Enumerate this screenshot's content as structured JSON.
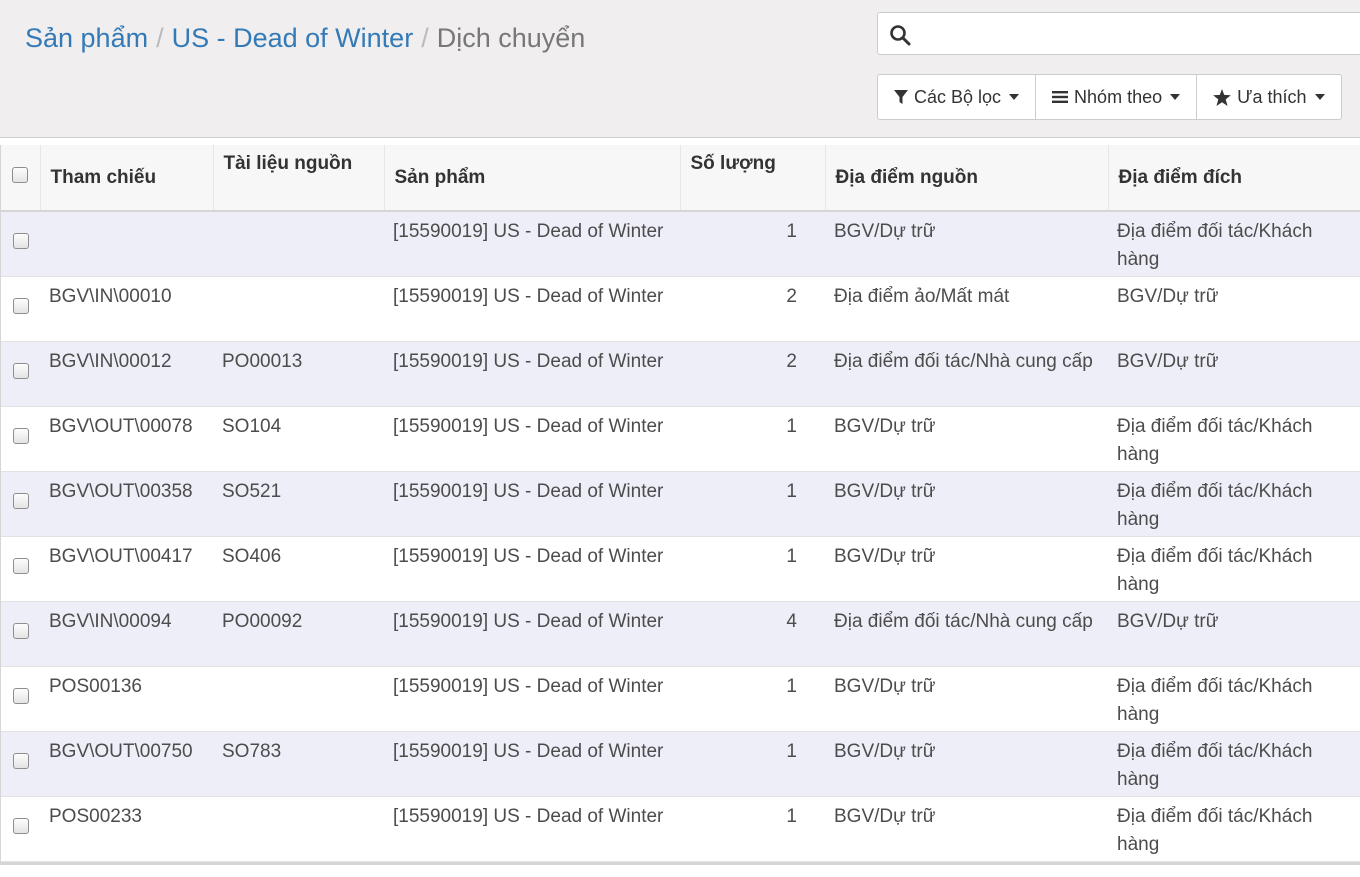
{
  "breadcrumb": {
    "items": [
      "Sản phẩm",
      "US - Dead of Winter"
    ],
    "current": "Dịch chuyển",
    "separator": "/"
  },
  "search": {
    "value": "",
    "placeholder": ""
  },
  "filters": {
    "filter_label": "Các Bộ lọc",
    "group_label": "Nhóm theo",
    "favorite_label": "Ưa thích"
  },
  "table": {
    "columns": [
      "Tham chiếu",
      "Tài liệu nguồn",
      "Sản phẩm",
      "Số lượng",
      "Địa điểm nguồn",
      "Địa điểm đích"
    ],
    "rows": [
      {
        "ref": "",
        "source_doc": "",
        "product": "[15590019] US - Dead of Winter",
        "qty": "1",
        "from": "BGV/Dự trữ",
        "to": "Địa điểm đối tác/Khách hàng"
      },
      {
        "ref": "BGV\\IN\\00010",
        "source_doc": "",
        "product": "[15590019] US - Dead of Winter",
        "qty": "2",
        "from": "Địa điểm ảo/Mất mát",
        "to": "BGV/Dự trữ"
      },
      {
        "ref": "BGV\\IN\\00012",
        "source_doc": "PO00013",
        "product": "[15590019] US - Dead of Winter",
        "qty": "2",
        "from": "Địa điểm đối tác/Nhà cung cấp",
        "to": "BGV/Dự trữ"
      },
      {
        "ref": "BGV\\OUT\\00078",
        "source_doc": "SO104",
        "product": "[15590019] US - Dead of Winter",
        "qty": "1",
        "from": "BGV/Dự trữ",
        "to": "Địa điểm đối tác/Khách hàng"
      },
      {
        "ref": "BGV\\OUT\\00358",
        "source_doc": "SO521",
        "product": "[15590019] US - Dead of Winter",
        "qty": "1",
        "from": "BGV/Dự trữ",
        "to": "Địa điểm đối tác/Khách hàng"
      },
      {
        "ref": "BGV\\OUT\\00417",
        "source_doc": "SO406",
        "product": "[15590019] US - Dead of Winter",
        "qty": "1",
        "from": "BGV/Dự trữ",
        "to": "Địa điểm đối tác/Khách hàng"
      },
      {
        "ref": "BGV\\IN\\00094",
        "source_doc": "PO00092",
        "product": "[15590019] US - Dead of Winter",
        "qty": "4",
        "from": "Địa điểm đối tác/Nhà cung cấp",
        "to": "BGV/Dự trữ"
      },
      {
        "ref": "POS00136",
        "source_doc": "",
        "product": "[15590019] US - Dead of Winter",
        "qty": "1",
        "from": "BGV/Dự trữ",
        "to": "Địa điểm đối tác/Khách hàng"
      },
      {
        "ref": "BGV\\OUT\\00750",
        "source_doc": "SO783",
        "product": "[15590019] US - Dead of Winter",
        "qty": "1",
        "from": "BGV/Dự trữ",
        "to": "Địa điểm đối tác/Khách hàng"
      },
      {
        "ref": "POS00233",
        "source_doc": "",
        "product": "[15590019] US - Dead of Winter",
        "qty": "1",
        "from": "BGV/Dự trữ",
        "to": "Địa điểm đối tác/Khách hàng"
      }
    ]
  },
  "colors": {
    "link": "#337ab7",
    "panel_bg": "#f0eeee",
    "row_odd": "#eeeef8"
  },
  "icons": {
    "search": "search-icon",
    "filter": "filter-icon",
    "group": "bars-icon",
    "favorite": "star-icon"
  }
}
